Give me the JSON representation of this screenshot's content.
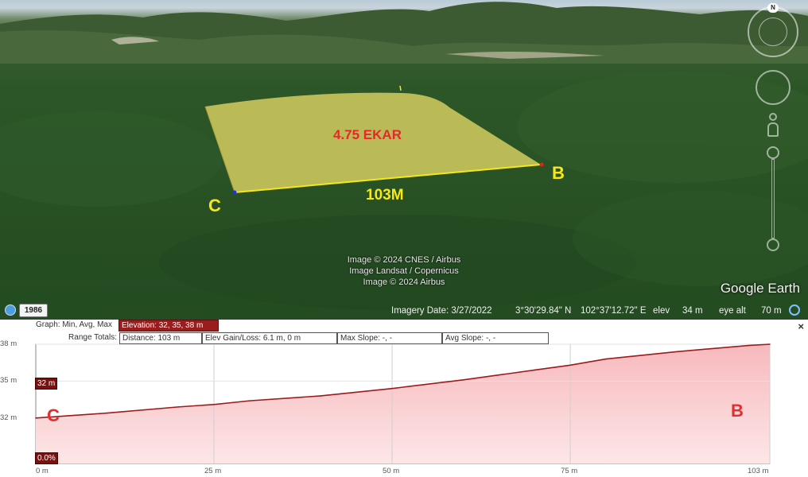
{
  "viewport": {
    "area_label": "4.75 EKAR",
    "distance_label": "103M",
    "point_b": "B",
    "point_c": "C",
    "credits": [
      "Image © 2024 CNES / Airbus",
      "Image Landsat / Copernicus",
      "Image © 2024 Airbus"
    ],
    "brand": "Google Earth",
    "compass_north": "N",
    "polygon_fill": "#c8c45a",
    "edge_color": "#f5e81a"
  },
  "statusbar": {
    "year": "1986",
    "imagery_date": "Imagery Date: 3/27/2022",
    "lat": "3°30'29.84\" N",
    "lon": "102°37'12.72\" E",
    "elev_label": "elev",
    "elev_value": "34 m",
    "eye_alt_label": "eye alt",
    "eye_alt_value": "70 m"
  },
  "profile": {
    "row1": {
      "graph_label": "Graph: Min, Avg, Max",
      "elevation": "Elevation: 32, 35, 38 m"
    },
    "row2": {
      "range_totals": "Range Totals:",
      "distance": "Distance: 103 m",
      "elev_gain_loss": "Elev Gain/Loss: 6.1 m, 0 m",
      "max_slope": "Max Slope: -, -",
      "avg_slope": "Avg Slope: -, -"
    },
    "close_glyph": "×",
    "start_elev_flag": "32 m",
    "start_slope_flag": "0.0%",
    "point_c": "C",
    "point_b": "B",
    "accent": "#9a1c1c",
    "fill": "#f8c6c8"
  },
  "chart_data": {
    "type": "area",
    "x": [
      0,
      10,
      20,
      25,
      30,
      40,
      50,
      60,
      70,
      75,
      80,
      90,
      100,
      103
    ],
    "y": [
      32,
      32.4,
      32.9,
      33.1,
      33.4,
      33.8,
      34.4,
      35.1,
      35.9,
      36.3,
      36.8,
      37.4,
      37.9,
      38
    ],
    "x_ticks": [
      "0 m",
      "25 m",
      "50 m",
      "75 m",
      "103 m"
    ],
    "x_tick_values": [
      0,
      25,
      50,
      75,
      103
    ],
    "y_ticks": [
      "38 m",
      "35 m",
      "32 m"
    ],
    "y_tick_values": [
      38,
      35,
      32
    ],
    "xlim": [
      0,
      103
    ],
    "ylim": [
      28.3,
      38
    ],
    "grid": true
  }
}
